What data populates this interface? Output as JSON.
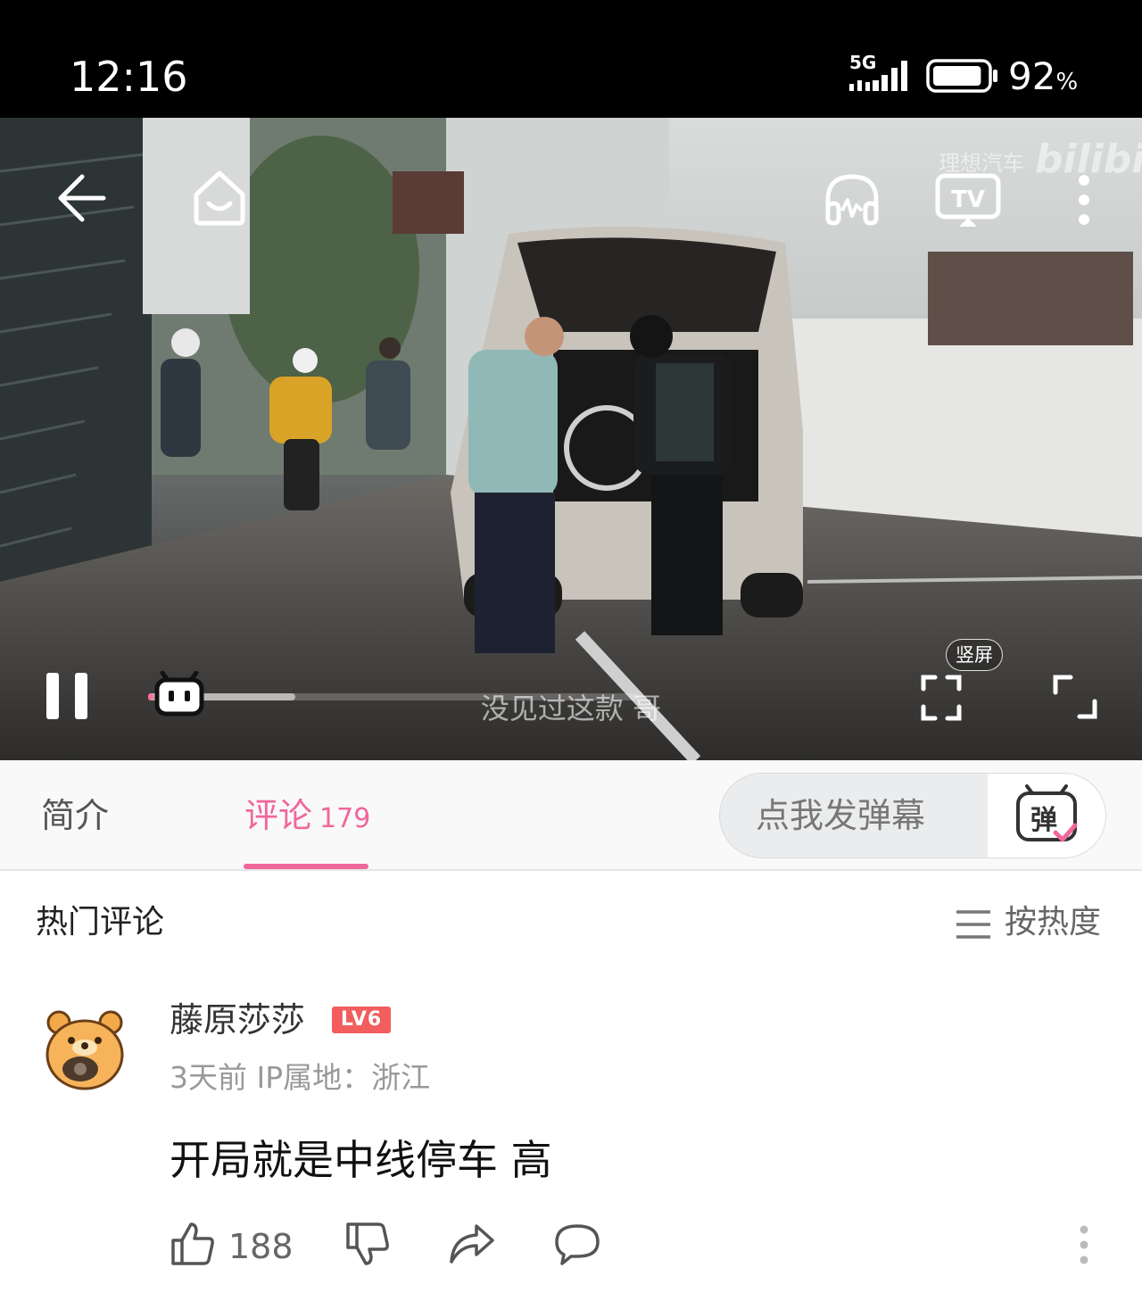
{
  "status_bar": {
    "time": "12:16",
    "network": "5G",
    "battery_percent": "92",
    "battery_unit": "%",
    "battery_level": 0.92
  },
  "player": {
    "watermark_brand": "理想汽车",
    "watermark_logo": "bilibili",
    "subtitle": "没见过这款 哥",
    "vertical_screen_label": "竖屏",
    "progress_played": 0.01,
    "progress_buffered": 0.3,
    "icons": [
      "back-arrow-icon",
      "home-icon",
      "audio-headphones-icon",
      "tv-cast-icon",
      "more-vertical-icon",
      "pause-icon",
      "fullscreen-vertical-icon",
      "fullscreen-icon"
    ]
  },
  "tabs": {
    "intro": "简介",
    "comments": "评论",
    "comments_count": "179"
  },
  "danmaku": {
    "placeholder": "点我发弹幕",
    "button_icon_text": "弹"
  },
  "comments_section": {
    "title": "热门评论",
    "sort_label": "按热度"
  },
  "comments": [
    {
      "username": "藤原莎莎",
      "level": "LV6",
      "meta": "3天前 IP属地：浙江",
      "text": "开局就是中线停车 高",
      "likes": "188"
    }
  ],
  "colors": {
    "accent_pink": "#fb7299",
    "tab_active": "#f0679a",
    "level_badge": "#f25d5d"
  }
}
